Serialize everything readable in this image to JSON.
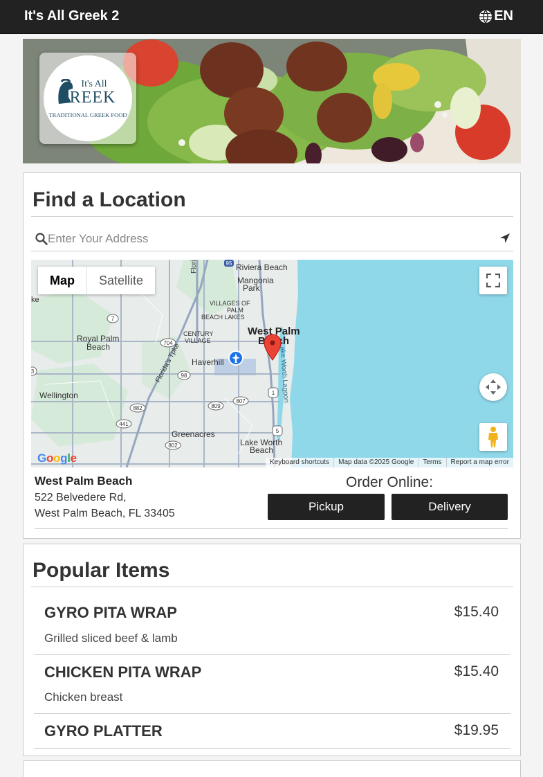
{
  "header": {
    "title": "It's All Greek 2",
    "language": "EN"
  },
  "logo": {
    "line1": "It's All",
    "line2": "REEK",
    "line3": "TRADITIONAL GREEK FOOD"
  },
  "find_location": {
    "heading": "Find a Location",
    "search_placeholder": "Enter Your Address"
  },
  "map": {
    "type_map": "Map",
    "type_satellite": "Satellite",
    "labels": {
      "riviera": "Riviera Beach",
      "mangonia": "Mangonia",
      "mangonia2": "Park",
      "villages1": "VILLAGES OF",
      "villages2": "PALM",
      "villages3": "BEACH LAKES",
      "wpb1": "West Palm",
      "wpb2": "Beach",
      "royal1": "Royal Palm",
      "royal2": "Beach",
      "century1": "CENTURY",
      "century2": "VILLAGE",
      "haverhill": "Haverhill",
      "tpke": "Florida's Tpke",
      "lagoon": "Lake Worth Lagoon",
      "wellington": "Wellington",
      "greenacres": "Greenacres",
      "lakeworth1": "Lake Worth",
      "lakeworth2": "Beach",
      "florida": "Florida",
      "ke": "ke",
      "shield_95": "95",
      "shield_7": "7",
      "shield_704": "704",
      "shield_98": "98",
      "shield_809": "809",
      "shield_807": "807",
      "shield_1": "1",
      "shield_5": "5",
      "shield_882": "882",
      "shield_441": "441",
      "shield_802": "802",
      "shield_3": "3"
    },
    "footer": [
      "Keyboard shortcuts",
      "Map data ©2025 Google",
      "Terms",
      "Report a map error"
    ],
    "google": "Google"
  },
  "location": {
    "name": "West Palm Beach",
    "address1": "522 Belvedere Rd,",
    "address2": "West Palm Beach, FL 33405"
  },
  "order": {
    "label": "Order Online:",
    "pickup": "Pickup",
    "delivery": "Delivery"
  },
  "popular": {
    "heading": "Popular Items",
    "items": [
      {
        "name": "GYRO PITA WRAP",
        "price": "$15.40",
        "desc": "Grilled sliced beef & lamb"
      },
      {
        "name": "CHICKEN PITA WRAP",
        "price": "$15.40",
        "desc": "Chicken breast"
      },
      {
        "name": "GYRO PLATTER",
        "price": "$19.95",
        "desc": ""
      }
    ]
  },
  "colors": {
    "header_bg": "#222222",
    "water": "#8fd8ea",
    "land": "#e8ecea",
    "pin": "#ea4335"
  }
}
